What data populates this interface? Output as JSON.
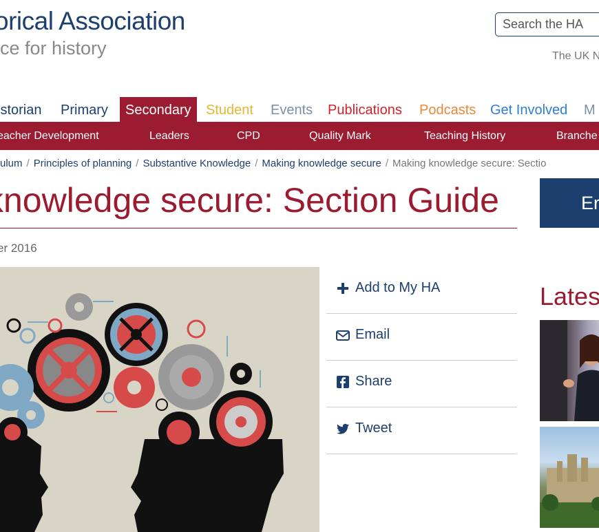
{
  "header": {
    "logo_title": "orical Association",
    "logo_subtitle": "ice for history",
    "search_placeholder": "Search the HA",
    "tagline": "The UK N"
  },
  "main_nav": [
    {
      "label": "istorian",
      "color": "#1d3f6e"
    },
    {
      "label": "Primary",
      "color": "#1d3f6e"
    },
    {
      "label": "Secondary",
      "color": "#ffffff",
      "active": true
    },
    {
      "label": "Student",
      "color": "#e8b52d"
    },
    {
      "label": "Events",
      "color": "#7a8fa6"
    },
    {
      "label": "Publications",
      "color": "#d2232a"
    },
    {
      "label": "Podcasts",
      "color": "#e8893a"
    },
    {
      "label": "Get Involved",
      "color": "#2e7dd7"
    },
    {
      "label": "M",
      "color": "#7a8fa6"
    }
  ],
  "sub_nav": [
    "eacher Development",
    "Leaders",
    "CPD",
    "Quality Mark",
    "Teaching History",
    "Branche"
  ],
  "breadcrumb": [
    "ulum",
    "Principles of planning",
    "Substantive Knowledge",
    "Making knowledge secure",
    "Making knowledge secure: Sectio"
  ],
  "page": {
    "title": "knowledge secure: Section Guide",
    "date": "er 2016"
  },
  "share_actions": [
    {
      "label": "Add to My HA",
      "icon": "plus-icon"
    },
    {
      "label": "Email",
      "icon": "envelope-icon"
    },
    {
      "label": "Share",
      "icon": "facebook-icon"
    },
    {
      "label": "Tweet",
      "icon": "twitter-icon"
    }
  ],
  "sidebar": {
    "enrol_label": "Er",
    "latest_heading": "Lates"
  },
  "colors": {
    "brand_red": "#9b1b30",
    "brand_blue": "#1d3f6e"
  }
}
